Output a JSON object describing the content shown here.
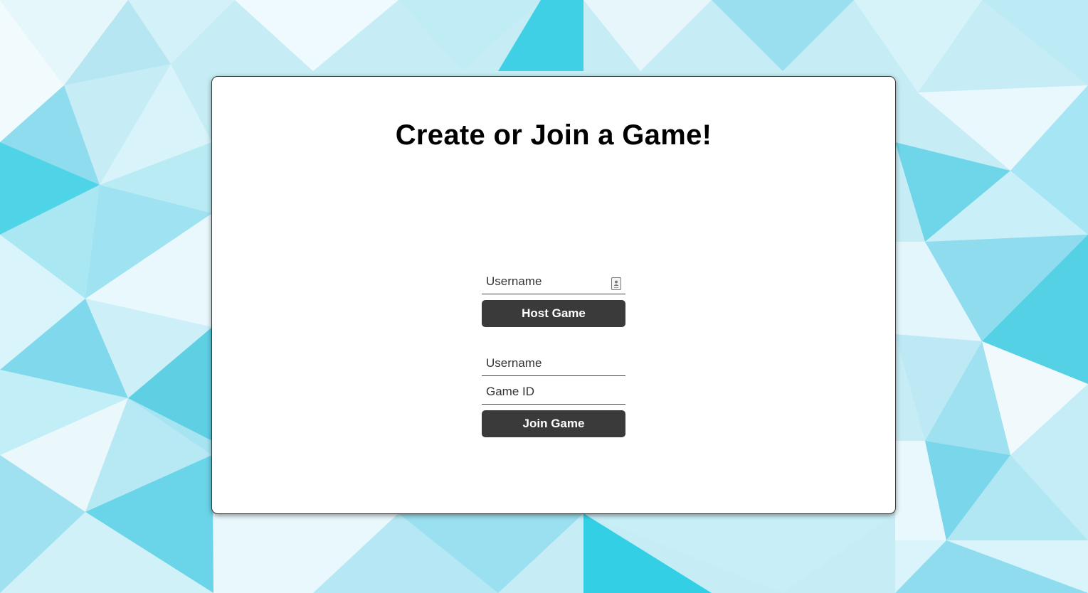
{
  "page": {
    "title": "Create or Join a Game!"
  },
  "host_form": {
    "username_placeholder": "Username",
    "username_value": "",
    "button_label": "Host Game"
  },
  "join_form": {
    "username_placeholder": "Username",
    "username_value": "",
    "game_id_placeholder": "Game ID",
    "game_id_value": "",
    "button_label": "Join Game"
  },
  "icons": {
    "autofill": "contact-card-icon"
  },
  "colors": {
    "background": "#bfeaf3",
    "card": "#ffffff",
    "button": "#3a3a3a",
    "button_text": "#ffffff"
  }
}
